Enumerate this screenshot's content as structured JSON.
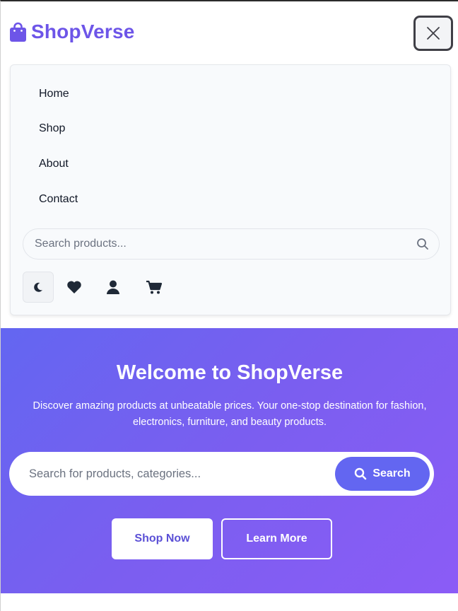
{
  "brand": {
    "name": "ShopVerse",
    "icon": "shopping-bag-icon",
    "color": "#6d55e8"
  },
  "header": {
    "close_icon": "close-icon"
  },
  "menu": {
    "items": [
      {
        "label": "Home"
      },
      {
        "label": "Shop"
      },
      {
        "label": "About"
      },
      {
        "label": "Contact"
      }
    ],
    "search": {
      "placeholder": "Search products...",
      "value": "",
      "icon": "search-icon"
    },
    "actions": [
      {
        "icon": "moon-icon"
      },
      {
        "icon": "heart-icon"
      },
      {
        "icon": "user-icon"
      },
      {
        "icon": "cart-icon"
      }
    ]
  },
  "hero": {
    "title": "Welcome to ShopVerse",
    "subtitle": "Discover amazing products at unbeatable prices. Your one-stop destination for fashion, electronics, furniture, and beauty products.",
    "search": {
      "placeholder": "Search for products, categories...",
      "value": "",
      "button_label": "Search"
    },
    "primary_button": "Shop Now",
    "secondary_button": "Learn More",
    "gradient": [
      "#6366f1",
      "#8b5cf6"
    ]
  }
}
